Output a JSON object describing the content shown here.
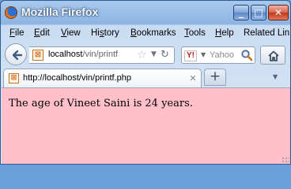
{
  "window": {
    "title": "Mozilla Firefox",
    "controls": {
      "minimize": "_",
      "maximize": "□",
      "close": "✕"
    }
  },
  "menubar": {
    "items": [
      {
        "key": "F",
        "rest": "ile"
      },
      {
        "key": "E",
        "rest": "dit"
      },
      {
        "key": "V",
        "rest": "iew"
      },
      {
        "key": "",
        "pre": "Hi",
        "keymid": "s",
        "rest": "tory"
      },
      {
        "key": "B",
        "rest": "ookmarks"
      },
      {
        "key": "T",
        "rest": "ools"
      },
      {
        "key": "H",
        "rest": "elp"
      },
      {
        "key": "",
        "pre": "Related Lin",
        "keymid": "",
        "rest": ""
      }
    ]
  },
  "navbar": {
    "url_host": "localhost",
    "url_path": "/vin/printf",
    "search_engine": "Y!",
    "search_placeholder": "Yahoo",
    "icons": {
      "back": "back-arrow-icon",
      "site": "site-identity-icon",
      "bookmark": "star-icon",
      "history_drop": "dropdown-icon",
      "reload": "reload-icon",
      "search": "magnifier-icon",
      "home": "home-icon"
    }
  },
  "tabs": [
    {
      "title": "http://localhost/vin/printf.php",
      "close": "✕"
    }
  ],
  "newtab_label": "+",
  "page": {
    "background": "#ffc0cb",
    "text": "The age of Vineet Saini is 24 years."
  }
}
